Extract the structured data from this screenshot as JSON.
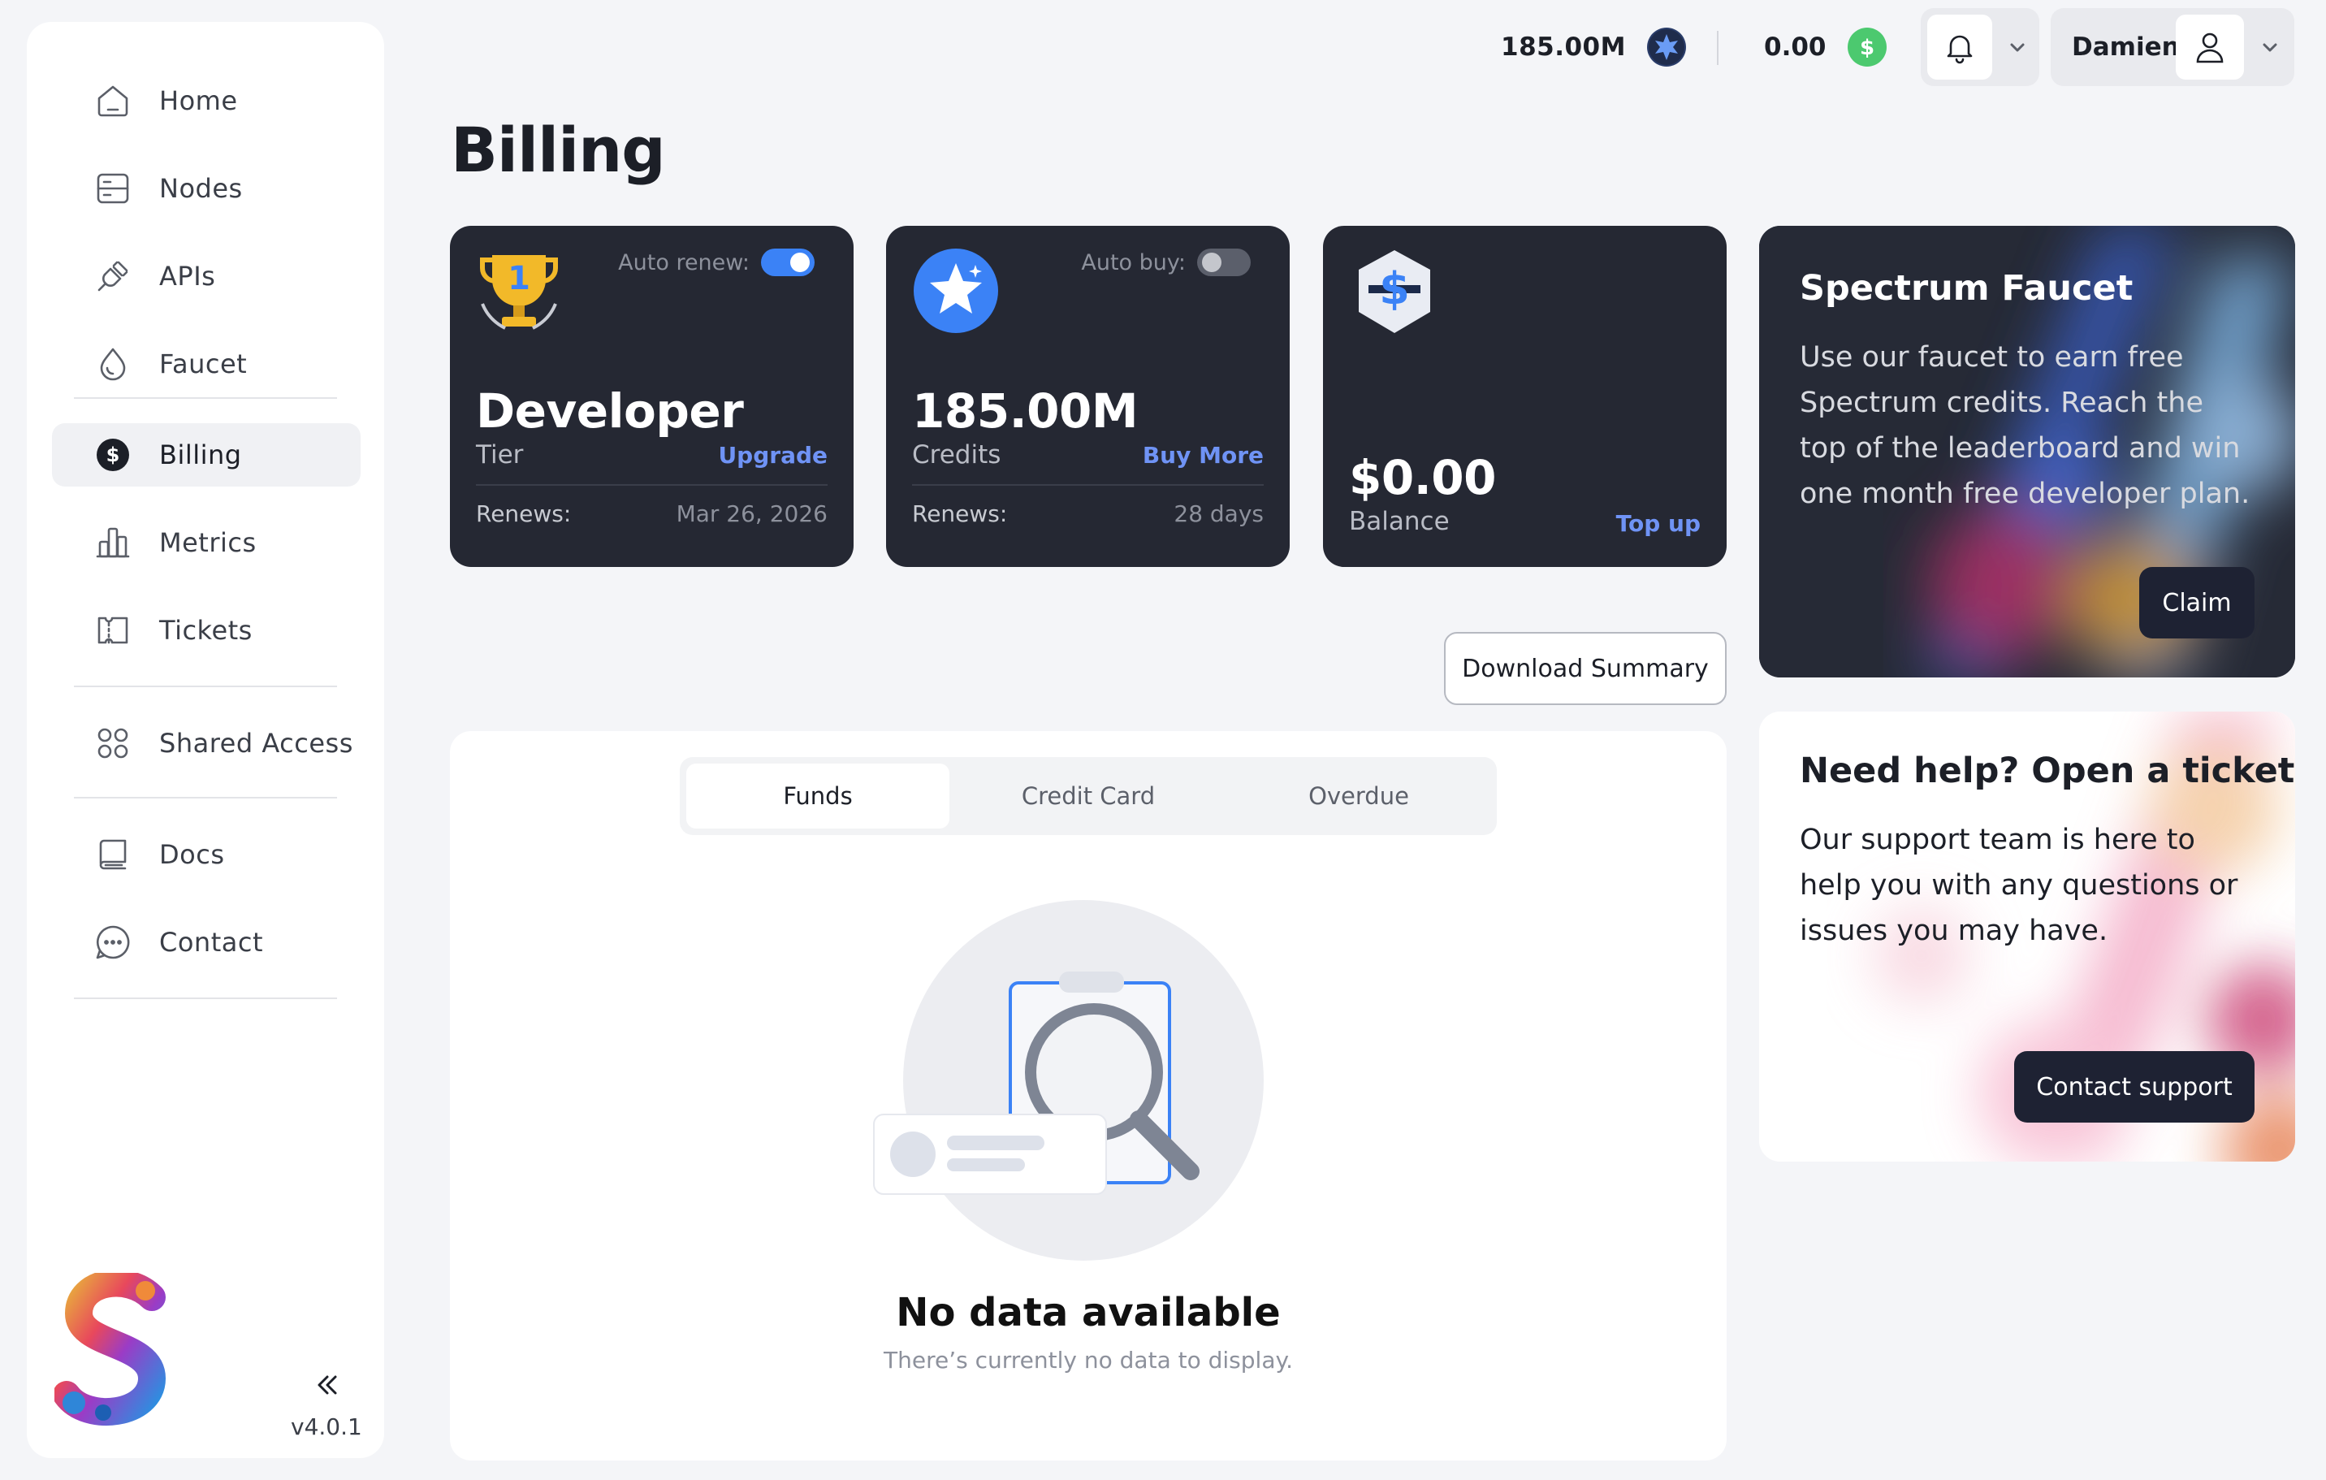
{
  "sidebar": {
    "items": [
      {
        "label": "Home",
        "icon": "home-icon"
      },
      {
        "label": "Nodes",
        "icon": "server-icon"
      },
      {
        "label": "APIs",
        "icon": "plug-icon"
      },
      {
        "label": "Faucet",
        "icon": "drop-icon"
      },
      {
        "label": "Billing",
        "icon": "dollar-icon",
        "active": true
      },
      {
        "label": "Metrics",
        "icon": "bar-chart-icon"
      },
      {
        "label": "Tickets",
        "icon": "ticket-icon"
      },
      {
        "label": "Shared Access",
        "icon": "grid-circles-icon"
      },
      {
        "label": "Docs",
        "icon": "book-icon"
      },
      {
        "label": "Contact",
        "icon": "chat-icon"
      }
    ],
    "version": "v4.0.1"
  },
  "topbar": {
    "credits": "185.00M",
    "balance": "0.00",
    "user_name": "Damien"
  },
  "page": {
    "title": "Billing"
  },
  "cards": {
    "tier": {
      "toggle_label": "Auto renew:",
      "toggle_on": true,
      "value": "Developer",
      "sub": "Tier",
      "link": "Upgrade",
      "renew_label": "Renews:",
      "renew_value": "Mar 26, 2026"
    },
    "credits": {
      "toggle_label": "Auto buy:",
      "toggle_on": false,
      "value": "185.00M",
      "sub": "Credits",
      "link": "Buy More",
      "renew_label": "Renews:",
      "renew_value": "28 days"
    },
    "balance": {
      "value": "$0.00",
      "sub": "Balance",
      "link": "Top up"
    }
  },
  "faucet": {
    "title": "Spectrum Faucet",
    "text": "Use our faucet to earn free Spectrum credits. Reach the top of the leaderboard and win one month free developer plan.",
    "button": "Claim"
  },
  "help": {
    "title": "Need help? Open a ticket",
    "text": "Our support team is here to help you with any questions or issues you may have.",
    "button": "Contact support"
  },
  "download": {
    "label": "Download Summary"
  },
  "tabs": [
    {
      "label": "Funds",
      "active": true
    },
    {
      "label": "Credit Card"
    },
    {
      "label": "Overdue"
    }
  ],
  "empty": {
    "title": "No data available",
    "subtitle": "There’s currently no data to display."
  },
  "colors": {
    "accent_blue": "#3b82f6",
    "link_blue": "#6f93f5",
    "dark_card": "#252833",
    "green_badge": "#4cc96f"
  }
}
